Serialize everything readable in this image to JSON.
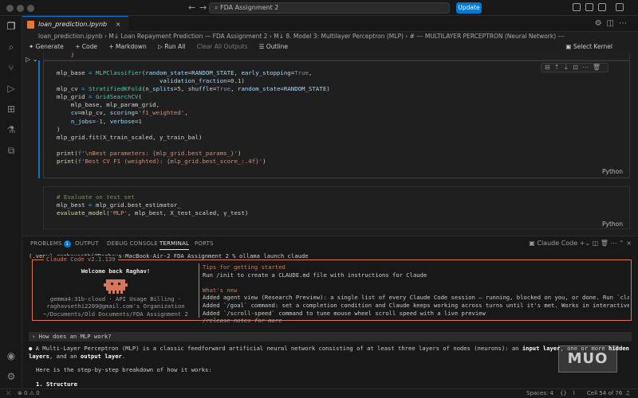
{
  "titlebar": {
    "search": "FDA Assignment 2",
    "update_label": "Update"
  },
  "tab": {
    "file_name": "loan_prediction.ipynb",
    "close": "×"
  },
  "breadcrumb": {
    "text": "loan_prediction.ipynb › M↓ Loan Repayment Prediction — FDA Assignment 2 › M↓ 8. Model 3: Multilayer Perceptron (MLP) › # --- MULTILAYER PERCEPTRON (Neural Network) ---"
  },
  "toolbar": {
    "generate": "✦ Generate",
    "code": "+ Code",
    "markdown": "+ Markdown",
    "run_all": "▷ Run All",
    "clear_all": "Clear All Outputs",
    "outline": "☰ Outline",
    "kernel": "Select Kernel"
  },
  "cells": {
    "lang": "Python"
  },
  "panel": {
    "tabs": [
      "PROBLEMS",
      "OUTPUT",
      "DEBUG CONSOLE",
      "TERMINAL",
      "PORTS"
    ],
    "problems_count": "1",
    "terminal_name": "Claude Code"
  },
  "terminal": {
    "prompt": "(.venv) raghavsethi@Raghavs-MacBook-Air-2 FDA Assignment 2 % ollama launch claude",
    "cc_title": "Claude Code v2.1.139",
    "welcome": "Welcome back Raghav!",
    "model_line": "gemma4:31b-cloud · API Usage Billing ·",
    "org_line": "raghavsethi2209@gmail.com's Organization",
    "path_line": "~/Documents/Old Documents/FDA Assignment 2",
    "tips_title": "Tips for getting started",
    "tips_text": "Run /init to create a CLAUDE.md file with instructions for Claude",
    "new_title": "What's new",
    "new_1": "Added agent view (Research Preview): a single list of every Claude Code session — running, blocked on you, or done. Run `claude agents` …",
    "new_2": "Added `/goal` command: set a completion condition and Claude keeps working across turns until it's met. Works in interactive, `-p`, and …",
    "new_3": "Added `/scroll-speed` command to tune mouse wheel scroll speed with a live preview",
    "new_4": "/release-notes for more",
    "question": "› How does an MLP work?",
    "answer_a": "A Multi-Layer Perceptron (MLP) is a classic feedforward artificial neural network consisting of at least three layers of nodes (neurons): an ",
    "answer_b": "input layer",
    "answer_c": ", one or more ",
    "answer_d": "hidden layers",
    "answer_e": ", and an ",
    "answer_f": "output layer",
    "answer_g": ".",
    "answer_2": "Here is the step-by-step breakdown of how it works:",
    "answer_3": "1. Structure"
  },
  "status": {
    "spaces": "Spaces: 4",
    "cell": "Cell 54 of 76"
  },
  "watermark": "MUO"
}
